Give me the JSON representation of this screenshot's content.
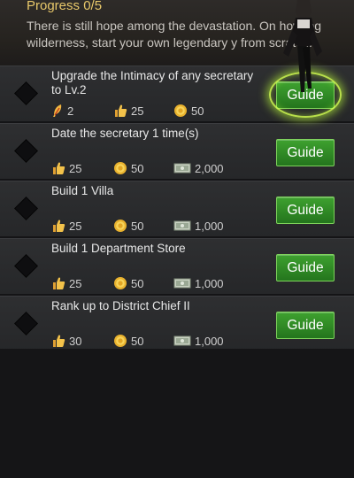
{
  "header": {
    "progress": "Progress 0/5",
    "story": "There is still hope among the devastation. On howling wilderness, start your own legendary y from scratch."
  },
  "tasks": [
    {
      "title": "Upgrade the Intimacy of any secretary to Lv.2",
      "rewards": [
        {
          "icon": "feather-icon",
          "value": "2"
        },
        {
          "icon": "thumbs-up-icon",
          "value": "25"
        },
        {
          "icon": "gold-coin-icon",
          "value": "50"
        }
      ],
      "button": "Guide",
      "highlighted": true
    },
    {
      "title": "Date the secretary 1 time(s)",
      "rewards": [
        {
          "icon": "thumbs-up-icon",
          "value": "25"
        },
        {
          "icon": "gold-coin-icon",
          "value": "50"
        },
        {
          "icon": "cash-icon",
          "value": "2,000"
        }
      ],
      "button": "Guide",
      "highlighted": false
    },
    {
      "title": "Build 1 Villa",
      "rewards": [
        {
          "icon": "thumbs-up-icon",
          "value": "25"
        },
        {
          "icon": "gold-coin-icon",
          "value": "50"
        },
        {
          "icon": "cash-icon",
          "value": "1,000"
        }
      ],
      "button": "Guide",
      "highlighted": false
    },
    {
      "title": "Build 1 Department Store",
      "rewards": [
        {
          "icon": "thumbs-up-icon",
          "value": "25"
        },
        {
          "icon": "gold-coin-icon",
          "value": "50"
        },
        {
          "icon": "cash-icon",
          "value": "1,000"
        }
      ],
      "button": "Guide",
      "highlighted": false
    },
    {
      "title": "Rank up to District Chief II",
      "rewards": [
        {
          "icon": "thumbs-up-icon",
          "value": "30"
        },
        {
          "icon": "gold-coin-icon",
          "value": "50"
        },
        {
          "icon": "cash-icon",
          "value": "1,000"
        }
      ],
      "button": "Guide",
      "highlighted": false
    }
  ]
}
